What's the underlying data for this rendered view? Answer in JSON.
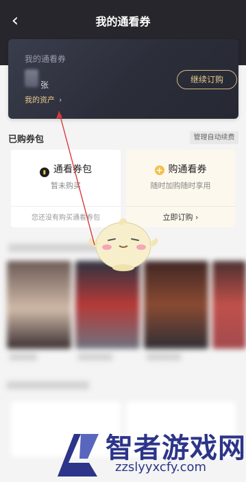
{
  "header": {
    "title": "我的通看券",
    "back_icon": "chevron-left-icon"
  },
  "asset_card": {
    "title": "我的通看券",
    "count_unit": "张",
    "my_assets": "我的资产",
    "renew_button": "继续订购"
  },
  "purchased": {
    "section_title": "已购券包",
    "manage_button": "管理自动续费"
  },
  "pass_package": {
    "title": "通看券包",
    "subtitle": "暂未购买",
    "footer": "您还没有购买通看券包"
  },
  "buy_pass": {
    "title": "购通看券",
    "subtitle": "随时加购随时享用",
    "footer": "立即订购"
  },
  "watermark": {
    "title": "智者游戏网",
    "url": "zzslyyxcfy.com"
  },
  "colors": {
    "header_bg": "#26262c",
    "gold": "#e9c98e",
    "accent_yellow": "#f2c14c",
    "watermark_blue": "#2c3589"
  }
}
